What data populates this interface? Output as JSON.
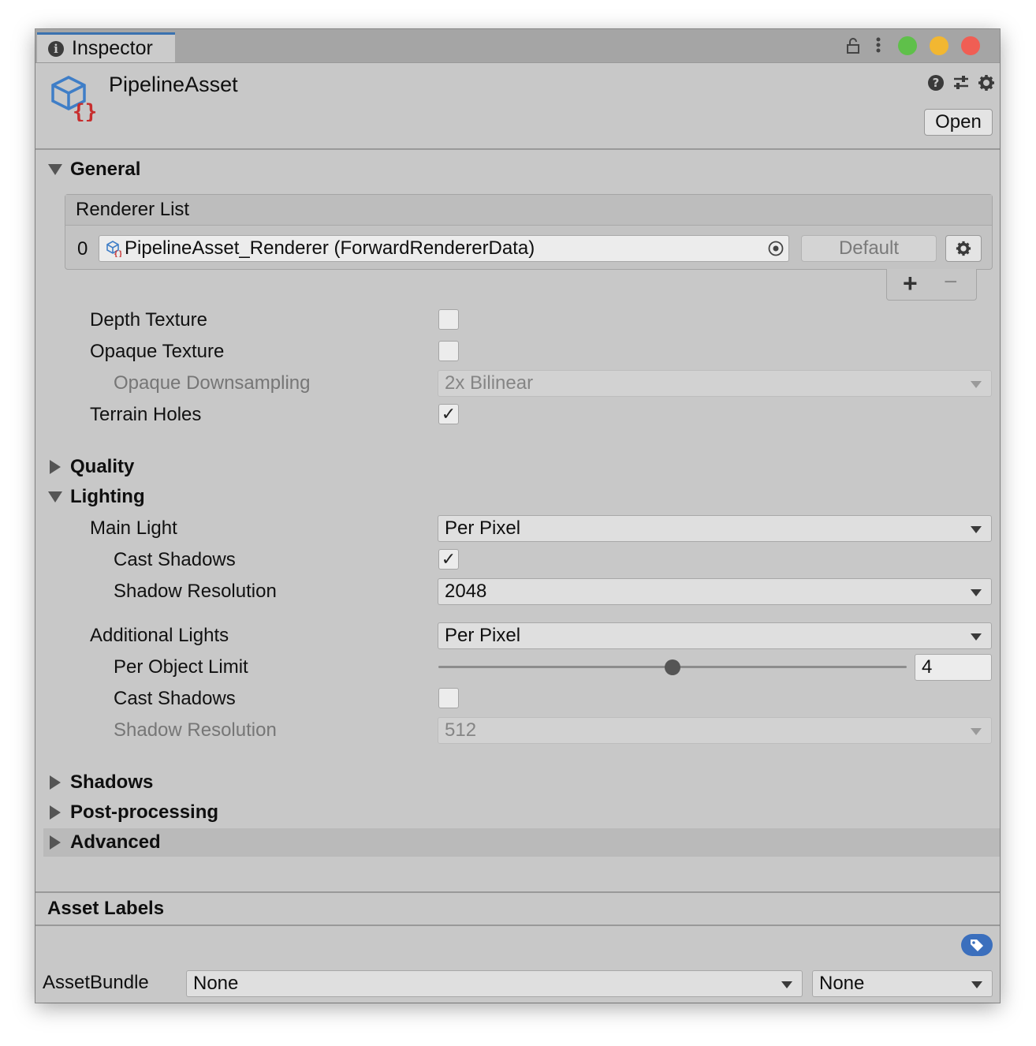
{
  "tab": {
    "title": "Inspector",
    "info_icon": "info-icon"
  },
  "titlebar": {
    "lock_icon": "lock-icon",
    "menu_icon": "kebab-menu-icon",
    "colors": {
      "green": "#5fc04a",
      "yellow": "#f2b731",
      "red": "#f05e54"
    }
  },
  "header": {
    "asset_name": "PipelineAsset",
    "open_label": "Open"
  },
  "general": {
    "title": "General",
    "renderer_list": {
      "title": "Renderer List",
      "items": [
        {
          "index": "0",
          "value": "PipelineAsset_Renderer (ForwardRendererData)",
          "default_label": "Default"
        }
      ],
      "add_label": "+",
      "remove_label": "−"
    },
    "fields": {
      "depth_texture": {
        "label": "Depth Texture",
        "checked": false
      },
      "opaque_texture": {
        "label": "Opaque Texture",
        "checked": false
      },
      "opaque_downsampling": {
        "label": "Opaque Downsampling",
        "value": "2x Bilinear"
      },
      "terrain_holes": {
        "label": "Terrain Holes",
        "checked": true
      }
    }
  },
  "quality": {
    "title": "Quality"
  },
  "lighting": {
    "title": "Lighting",
    "main_light": {
      "label": "Main Light",
      "value": "Per Pixel"
    },
    "main_cast_shadows": {
      "label": "Cast Shadows",
      "checked": true
    },
    "main_shadow_resolution": {
      "label": "Shadow Resolution",
      "value": "2048"
    },
    "additional_lights": {
      "label": "Additional Lights",
      "value": "Per Pixel"
    },
    "per_object_limit": {
      "label": "Per Object Limit",
      "value": "4",
      "fraction": 0.5
    },
    "add_cast_shadows": {
      "label": "Cast Shadows",
      "checked": false
    },
    "add_shadow_resolution": {
      "label": "Shadow Resolution",
      "value": "512"
    }
  },
  "shadows": {
    "title": "Shadows"
  },
  "post_processing": {
    "title": "Post-processing"
  },
  "advanced": {
    "title": "Advanced"
  },
  "footer": {
    "title": "Asset Labels",
    "assetbundle_label": "AssetBundle",
    "bundle_value": "None",
    "variant_value": "None"
  },
  "check_glyph": "✓"
}
